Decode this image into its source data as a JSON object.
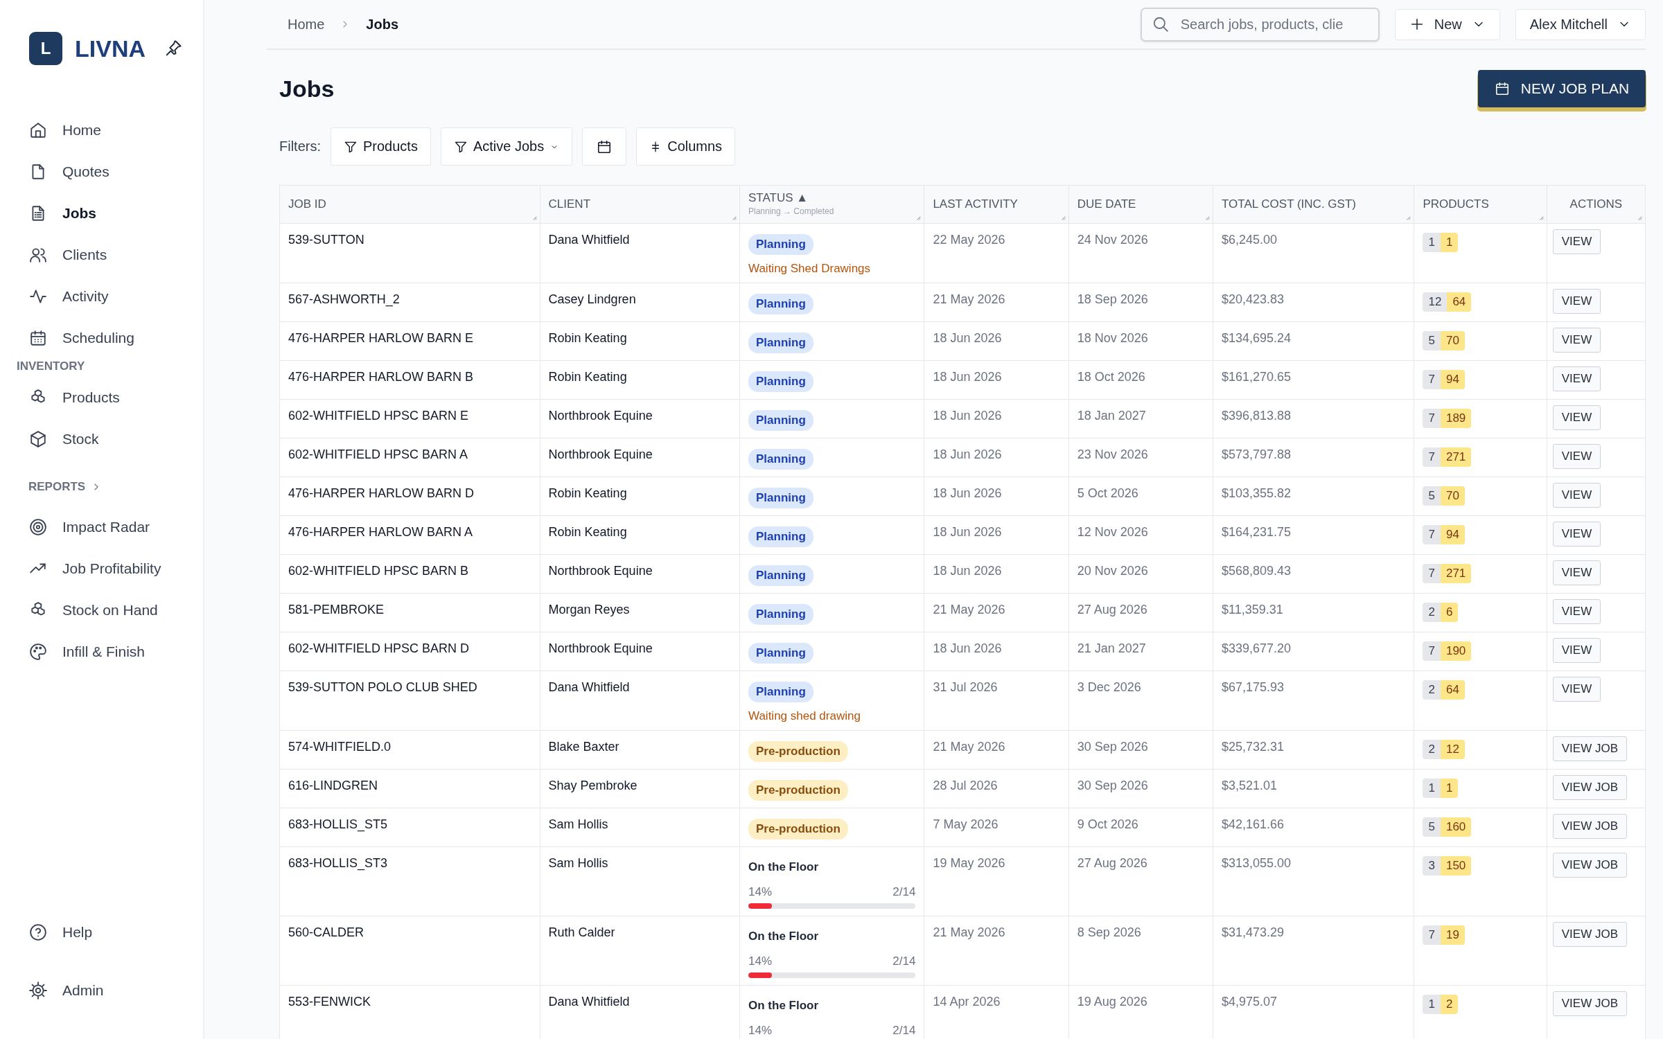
{
  "sidebar": {
    "logo_letter": "L",
    "brand": "LIVNA",
    "nav": [
      {
        "label": "Home",
        "selected": false
      },
      {
        "label": "Quotes",
        "selected": false
      },
      {
        "label": "Jobs",
        "selected": true
      },
      {
        "label": "Clients",
        "selected": false
      },
      {
        "label": "Activity",
        "selected": false
      },
      {
        "label": "Scheduling",
        "selected": false
      }
    ],
    "sections": [
      {
        "heading": "INVENTORY",
        "collapsible": false,
        "items": [
          {
            "label": "Products",
            "selected": false
          },
          {
            "label": "Stock",
            "selected": false
          }
        ]
      },
      {
        "heading": "REPORTS",
        "collapsible": true,
        "items": [
          {
            "label": "Impact Radar",
            "selected": false
          },
          {
            "label": "Job Profitability",
            "selected": false
          },
          {
            "label": "Stock on Hand",
            "selected": false
          },
          {
            "label": "Infill & Finish",
            "selected": false
          }
        ]
      }
    ],
    "footer": [
      {
        "label": "Help",
        "selected": false
      },
      {
        "label": "Admin",
        "selected": false
      }
    ]
  },
  "header": {
    "breadcrumb": [
      "Home",
      "Jobs"
    ],
    "search": {
      "placeholder": "Search jobs, products, clie"
    },
    "new_button": "New",
    "user": "Alex Mitchell"
  },
  "page": {
    "title": "Jobs",
    "primary_button": "NEW JOB PLAN",
    "filters_label": "Filters:",
    "filters": [
      {
        "kind": "filter",
        "label": "Products"
      },
      {
        "kind": "dropdown",
        "label": "Active Jobs"
      },
      {
        "kind": "date"
      },
      {
        "kind": "columns",
        "label": "Columns"
      }
    ]
  },
  "table": {
    "columns": [
      {
        "label": "JOB ID"
      },
      {
        "label": "CLIENT"
      },
      {
        "label": "STATUS",
        "sort": "▲",
        "sub": "Planning → Completed"
      },
      {
        "label": "LAST ACTIVITY"
      },
      {
        "label": "DUE DATE"
      },
      {
        "label": "TOTAL COST (INC. GST)"
      },
      {
        "label": "PRODUCTS"
      },
      {
        "label": "ACTIONS"
      }
    ],
    "rows": [
      {
        "job_id": "539-SUTTON",
        "client": "Dana Whitfield",
        "status": {
          "kind": "planning",
          "label": "Planning",
          "note": "Waiting Shed Drawings"
        },
        "last_activity": "22 May 2026",
        "due_date": "24 Nov 2026",
        "total_cost": "$6,245.00",
        "products": [
          "1",
          "1"
        ],
        "action": "VIEW"
      },
      {
        "job_id": "567-ASHWORTH_2",
        "client": "Casey Lindgren",
        "status": {
          "kind": "planning",
          "label": "Planning"
        },
        "last_activity": "21 May 2026",
        "due_date": "18 Sep 2026",
        "total_cost": "$20,423.83",
        "products": [
          "12",
          "64"
        ],
        "action": "VIEW"
      },
      {
        "job_id": "476-HARPER HARLOW BARN E",
        "client": "Robin Keating",
        "status": {
          "kind": "planning",
          "label": "Planning"
        },
        "last_activity": "18 Jun 2026",
        "due_date": "18 Nov 2026",
        "total_cost": "$134,695.24",
        "products": [
          "5",
          "70"
        ],
        "action": "VIEW"
      },
      {
        "job_id": "476-HARPER HARLOW BARN B",
        "client": "Robin Keating",
        "status": {
          "kind": "planning",
          "label": "Planning"
        },
        "last_activity": "18 Jun 2026",
        "due_date": "18 Oct 2026",
        "total_cost": "$161,270.65",
        "products": [
          "7",
          "94"
        ],
        "action": "VIEW"
      },
      {
        "job_id": "602-WHITFIELD HPSC BARN E",
        "client": "Northbrook Equine",
        "status": {
          "kind": "planning",
          "label": "Planning"
        },
        "last_activity": "18 Jun 2026",
        "due_date": "18 Jan 2027",
        "total_cost": "$396,813.88",
        "products": [
          "7",
          "189"
        ],
        "action": "VIEW"
      },
      {
        "job_id": "602-WHITFIELD HPSC BARN A",
        "client": "Northbrook Equine",
        "status": {
          "kind": "planning",
          "label": "Planning"
        },
        "last_activity": "18 Jun 2026",
        "due_date": "23 Nov 2026",
        "total_cost": "$573,797.88",
        "products": [
          "7",
          "271"
        ],
        "action": "VIEW"
      },
      {
        "job_id": "476-HARPER HARLOW BARN D",
        "client": "Robin Keating",
        "status": {
          "kind": "planning",
          "label": "Planning"
        },
        "last_activity": "18 Jun 2026",
        "due_date": "5 Oct 2026",
        "total_cost": "$103,355.82",
        "products": [
          "5",
          "70"
        ],
        "action": "VIEW"
      },
      {
        "job_id": "476-HARPER HARLOW BARN A",
        "client": "Robin Keating",
        "status": {
          "kind": "planning",
          "label": "Planning"
        },
        "last_activity": "18 Jun 2026",
        "due_date": "12 Nov 2026",
        "total_cost": "$164,231.75",
        "products": [
          "7",
          "94"
        ],
        "action": "VIEW"
      },
      {
        "job_id": "602-WHITFIELD HPSC BARN B",
        "client": "Northbrook Equine",
        "status": {
          "kind": "planning",
          "label": "Planning"
        },
        "last_activity": "18 Jun 2026",
        "due_date": "20 Nov 2026",
        "total_cost": "$568,809.43",
        "products": [
          "7",
          "271"
        ],
        "action": "VIEW"
      },
      {
        "job_id": "581-PEMBROKE",
        "client": "Morgan Reyes",
        "status": {
          "kind": "planning",
          "label": "Planning"
        },
        "last_activity": "21 May 2026",
        "due_date": "27 Aug 2026",
        "total_cost": "$11,359.31",
        "products": [
          "2",
          "6"
        ],
        "action": "VIEW"
      },
      {
        "job_id": "602-WHITFIELD HPSC BARN D",
        "client": "Northbrook Equine",
        "status": {
          "kind": "planning",
          "label": "Planning"
        },
        "last_activity": "18 Jun 2026",
        "due_date": "21 Jan 2027",
        "total_cost": "$339,677.20",
        "products": [
          "7",
          "190"
        ],
        "action": "VIEW"
      },
      {
        "job_id": "539-SUTTON POLO CLUB SHED",
        "client": "Dana Whitfield",
        "status": {
          "kind": "planning",
          "label": "Planning",
          "note": "Waiting shed drawing"
        },
        "last_activity": "31 Jul 2026",
        "due_date": "3 Dec 2026",
        "total_cost": "$67,175.93",
        "products": [
          "2",
          "64"
        ],
        "action": "VIEW"
      },
      {
        "job_id": "574-WHITFIELD.0",
        "client": "Blake Baxter",
        "status": {
          "kind": "preproduction",
          "label": "Pre-production"
        },
        "last_activity": "21 May 2026",
        "due_date": "30 Sep 2026",
        "total_cost": "$25,732.31",
        "products": [
          "2",
          "12"
        ],
        "action": "VIEW JOB"
      },
      {
        "job_id": "616-LINDGREN",
        "client": "Shay Pembroke",
        "status": {
          "kind": "preproduction",
          "label": "Pre-production"
        },
        "last_activity": "28 Jul 2026",
        "due_date": "30 Sep 2026",
        "total_cost": "$3,521.01",
        "products": [
          "1",
          "1"
        ],
        "action": "VIEW JOB"
      },
      {
        "job_id": "683-HOLLIS_ST5",
        "client": "Sam Hollis",
        "status": {
          "kind": "preproduction",
          "label": "Pre-production"
        },
        "last_activity": "7 May 2026",
        "due_date": "9 Oct 2026",
        "total_cost": "$42,161.66",
        "products": [
          "5",
          "160"
        ],
        "action": "VIEW JOB"
      },
      {
        "job_id": "683-HOLLIS_ST3",
        "client": "Sam Hollis",
        "status": {
          "kind": "floor",
          "label": "On the Floor",
          "percent": "14%",
          "count": "2/14",
          "level": 0.14
        },
        "last_activity": "19 May 2026",
        "due_date": "27 Aug 2026",
        "total_cost": "$313,055.00",
        "products": [
          "3",
          "150"
        ],
        "action": "VIEW JOB"
      },
      {
        "job_id": "560-CALDER",
        "client": "Ruth Calder",
        "status": {
          "kind": "floor",
          "label": "On the Floor",
          "percent": "14%",
          "count": "2/14",
          "level": 0.14
        },
        "last_activity": "21 May 2026",
        "due_date": "8 Sep 2026",
        "total_cost": "$31,473.29",
        "products": [
          "7",
          "19"
        ],
        "action": "VIEW JOB"
      },
      {
        "job_id": "553-FENWICK",
        "client": "Dana Whitfield",
        "status": {
          "kind": "floor",
          "label": "On the Floor",
          "percent": "14%",
          "count": "2/14"
        },
        "last_activity": "14 Apr 2026",
        "due_date": "19 Aug 2026",
        "total_cost": "$4,975.07",
        "products": [
          "1",
          "2"
        ],
        "action": "VIEW JOB"
      }
    ]
  }
}
